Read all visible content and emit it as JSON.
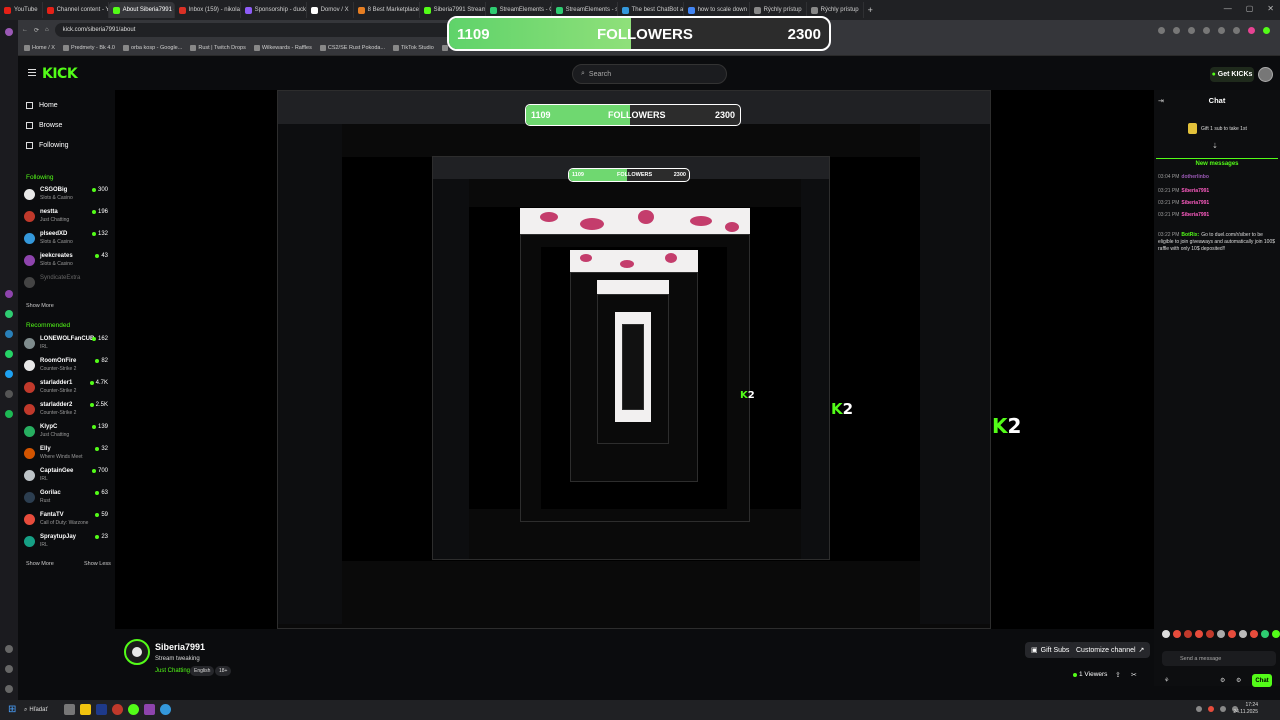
{
  "browser": {
    "tabs": [
      {
        "label": "YouTube",
        "color": "#e62117"
      },
      {
        "label": "Channel content - YouTub",
        "color": "#e62117"
      },
      {
        "label": "About Siberia7991 - Kick",
        "color": "#53fc18",
        "active": true
      },
      {
        "label": "Inbox (159) - nikolasrc",
        "color": "#d93025"
      },
      {
        "label": "Sponsorship - duck@...",
        "color": "#8e5cf7"
      },
      {
        "label": "Domov / X",
        "color": "#ffffff"
      },
      {
        "label": "8 Best Marketplaces to B",
        "color": "#e67e22"
      },
      {
        "label": "Siberia7991 Stream - Kick",
        "color": "#53fc18"
      },
      {
        "label": "StreamElements - Overla",
        "color": "#2ecc71"
      },
      {
        "label": "StreamElements - siberia",
        "color": "#2ecc71"
      },
      {
        "label": "The best ChatBot and W",
        "color": "#3498db"
      },
      {
        "label": "how to scale down 3440",
        "color": "#4285f4"
      },
      {
        "label": "Rýchly prístup",
        "color": "#888888"
      },
      {
        "label": "Rýchly prístup",
        "color": "#888888"
      }
    ],
    "url": "kick.com/siberia7991/about",
    "bookmarks": [
      "Home / X",
      "Predmety - Bk 4.0",
      "orba kosp - Google...",
      "Rust | Twitch Drops",
      "Wilkewards - Raffles",
      "CS2/SE Rust Pokoda...",
      "TikTok Studio",
      "Channel content - Y...",
      "Y8Mp3: YouTube"
    ]
  },
  "overlay": {
    "followers_label": "FOLLOWERS",
    "current": "1109",
    "goal": "2300",
    "progress": 0.48
  },
  "header": {
    "logo": "KICK",
    "search_placeholder": "Search",
    "get_kicks": "Get KICKs"
  },
  "nav": {
    "home": "Home",
    "browse": "Browse",
    "following": "Following",
    "following_title": "Following",
    "recommended_title": "Recommended",
    "show_more": "Show More",
    "show_less": "Show Less",
    "following_channels": [
      {
        "name": "CSGOBig",
        "category": "Slots & Casino",
        "viewers": "300",
        "color": "#e8e8e8"
      },
      {
        "name": "nestta",
        "category": "Just Chatting",
        "viewers": "196",
        "color": "#c0392b"
      },
      {
        "name": "plseedXD",
        "category": "Slots & Casino",
        "viewers": "132",
        "color": "#3498db"
      },
      {
        "name": "jeekcreates",
        "category": "Slots & Casino",
        "viewers": "43",
        "color": "#8e44ad"
      },
      {
        "name": "SyndicateExtra",
        "category": "",
        "viewers": "",
        "color": "#444444",
        "offline": true
      }
    ],
    "recommended_channels": [
      {
        "name": "LONEWOLFanCUB",
        "category": "IRL",
        "viewers": "162",
        "color": "#7f8c8d"
      },
      {
        "name": "RoomOnFire",
        "category": "Counter-Strike 2",
        "viewers": "82",
        "color": "#e8e8e8"
      },
      {
        "name": "starladder1",
        "category": "Counter-Strike 2",
        "viewers": "4.7K",
        "color": "#c0392b"
      },
      {
        "name": "starladder2",
        "category": "Counter-Strike 2",
        "viewers": "2.5K",
        "color": "#c0392b"
      },
      {
        "name": "KlypC",
        "category": "Just Chatting",
        "viewers": "139",
        "color": "#27ae60"
      },
      {
        "name": "Elly",
        "category": "Where Winds Meet",
        "viewers": "32",
        "color": "#d35400"
      },
      {
        "name": "CaptainGee",
        "category": "IRL",
        "viewers": "700",
        "color": "#bdc3c7"
      },
      {
        "name": "Gorilac",
        "category": "Rust",
        "viewers": "63",
        "color": "#2c3e50"
      },
      {
        "name": "FantaTV",
        "category": "Call of Duty: Warzone",
        "viewers": "59",
        "color": "#e74c3c"
      },
      {
        "name": "SpraytupJay",
        "category": "IRL",
        "viewers": "23",
        "color": "#16a085"
      }
    ]
  },
  "stream_overlay": {
    "k2_text": "2"
  },
  "chat": {
    "title": "Chat",
    "gift_banner": "Gift 1 sub to take 1st",
    "new_messages": "New messages",
    "messages": [
      {
        "time": "03:04 PM",
        "user": "dotherlinbo",
        "text": "",
        "color": "#9b59b6"
      },
      {
        "time": "03:21 PM",
        "user": "Siberia7991",
        "text": "",
        "color": "#ff5cc3"
      },
      {
        "time": "03:21 PM",
        "user": "Siberia7991",
        "text": "",
        "color": "#ff5cc3"
      },
      {
        "time": "03:21 PM",
        "user": "Siberia7991",
        "text": "",
        "color": "#ff5cc3"
      },
      {
        "time": "03:22 PM",
        "user": "BotRix:",
        "text": "Go to duel.com/r/siber to be eligible to join giveaways and automatically join 100$ raffle with only 10$ deposited!!",
        "color": "#53fc18"
      }
    ],
    "input_placeholder": "Send a message",
    "send": "Chat"
  },
  "channel": {
    "name": "Siberia7991",
    "title": "Stream tweaking",
    "category": "Just Chatting",
    "language": "English",
    "age": "18+",
    "gift_subs": "Gift Subs",
    "customize": "Customize channel",
    "viewers": "1 Viewers"
  },
  "taskbar": {
    "search": "Hľadať",
    "time": "17:24",
    "date": "24.11.2025"
  }
}
